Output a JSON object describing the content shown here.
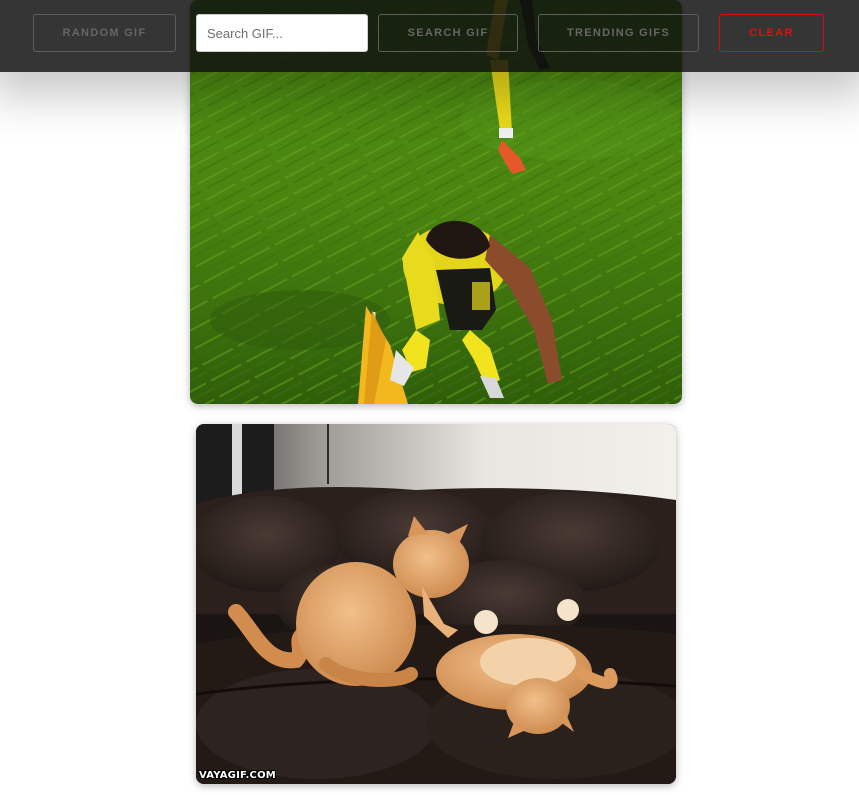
{
  "toolbar": {
    "random_label": "RANDOM GIF",
    "search_placeholder": "Search GIF...",
    "search_value": "",
    "search_label": "SEARCH GIF",
    "trending_label": "TRENDING GIFS",
    "clear_label": "CLEAR"
  },
  "gifs": [
    {
      "subject": "soccer player falling near corner flag"
    },
    {
      "subject": "two orange cats playing on leather couch",
      "watermark": "VAYAGIF.COM"
    }
  ],
  "colors": {
    "toolbar_bg": "#0e0e0e",
    "button_text": "#666666",
    "clear_accent": "#e01010",
    "grass": "#4f8a10",
    "player_kit": "#f2e21a",
    "cat_fur": "#d99a5c",
    "couch": "#2b201c"
  },
  "icons": {
    "gif_1": "soccer-gif-image",
    "gif_2": "cats-gif-image"
  }
}
